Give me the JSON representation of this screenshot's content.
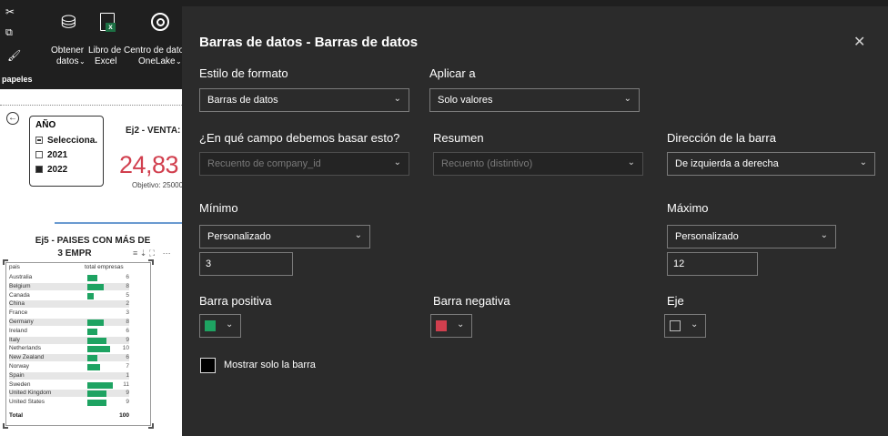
{
  "ribbon": {
    "get_data_label": "Obtener\ndatos",
    "get_data_line1": "Obtener",
    "get_data_line2": "datos",
    "excel_line1": "Libro de",
    "excel_line2": "Excel",
    "onelake_line1": "Centro de dato",
    "onelake_line2": "OneLake",
    "group_label": "papeles"
  },
  "report": {
    "slicer": {
      "title": "AÑO",
      "options": [
        "Selecciona...",
        "2021",
        "2022"
      ]
    },
    "kpi": {
      "title": "Ej2 - VENTA:",
      "value": "24,83",
      "goal": "Objetivo: 25000"
    },
    "table_visual": {
      "title_line1": "Ej5 - PAISES CON MÁS DE",
      "title_line2": "3 EMPR",
      "col_country": "pais",
      "col_total": "total empresas",
      "rows": [
        {
          "country": "Australia",
          "value": 6
        },
        {
          "country": "Belgium",
          "value": 8
        },
        {
          "country": "Canada",
          "value": 5
        },
        {
          "country": "China",
          "value": 2
        },
        {
          "country": "France",
          "value": 3
        },
        {
          "country": "Germany",
          "value": 8
        },
        {
          "country": "Ireland",
          "value": 6
        },
        {
          "country": "Italy",
          "value": 9
        },
        {
          "country": "Netherlands",
          "value": 10
        },
        {
          "country": "New Zealand",
          "value": 6
        },
        {
          "country": "Norway",
          "value": 7
        },
        {
          "country": "Spain",
          "value": 1
        },
        {
          "country": "Sweden",
          "value": 11
        },
        {
          "country": "United Kingdom",
          "value": 9
        },
        {
          "country": "United States",
          "value": 9
        }
      ],
      "total_label": "Total",
      "total_value": "100",
      "bar_color": "#1ea362"
    }
  },
  "dialog": {
    "title": "Barras de datos - Barras de datos",
    "format_style_label": "Estilo de formato",
    "format_style_value": "Barras de datos",
    "apply_to_label": "Aplicar a",
    "apply_to_value": "Solo valores",
    "field_label": "¿En qué campo debemos basar esto?",
    "field_value": "Recuento de company_id",
    "summary_label": "Resumen",
    "summary_value": "Recuento (distintivo)",
    "direction_label": "Dirección de la barra",
    "direction_value": "De izquierda a derecha",
    "min_label": "Mínimo",
    "min_type": "Personalizado",
    "min_value": "3",
    "max_label": "Máximo",
    "max_type": "Personalizado",
    "max_value": "12",
    "positive_bar_label": "Barra positiva",
    "positive_color": "#1ea362",
    "negative_bar_label": "Barra negativa",
    "negative_color": "#d13f4e",
    "axis_label": "Eje",
    "show_bar_only_label": "Mostrar solo la barra",
    "show_bar_only_checked": false
  }
}
